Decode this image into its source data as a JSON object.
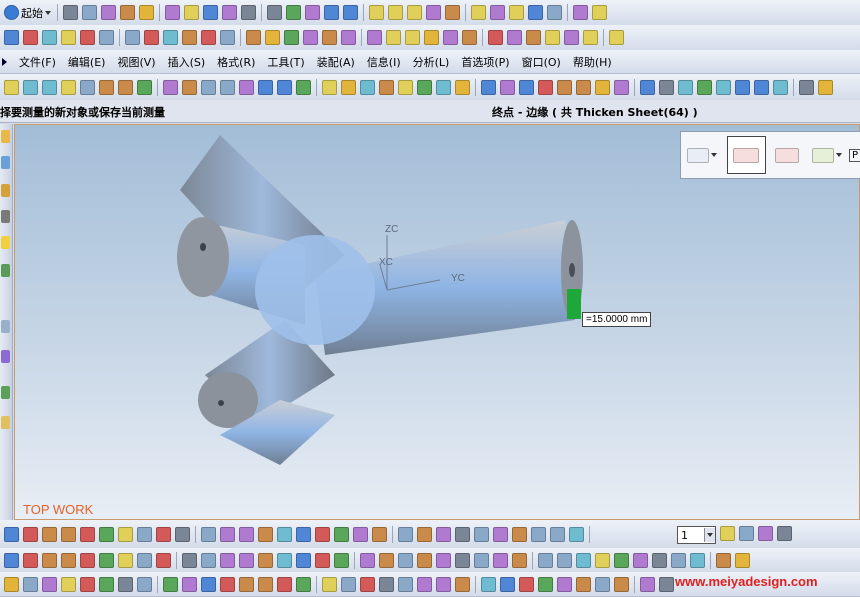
{
  "toolbar_top": {
    "start_label": "起始",
    "icons_row1": [
      "new-icon",
      "open-icon",
      "save-icon",
      "cut-icon",
      "copy-icon",
      "paste-icon",
      "delete-icon",
      "undo-icon",
      "repeat-icon",
      "select-icon",
      "fit-icon",
      "shaded-icon",
      "zoom-icon",
      "rotate-icon",
      "pan-icon",
      "view-cube-icon",
      "layout-icon",
      "wcs-icon",
      "orient-icon",
      "layer-icon",
      "edit-icon",
      "analyze-icon",
      "material-icon",
      "lights-icon",
      "scene-icon",
      "photo-icon",
      "render-icon"
    ],
    "icons_row2": [
      "point-icon",
      "curve-icon",
      "plane-icon",
      "datum-icon",
      "sketch-icon",
      "x2-icon",
      "transform-icon",
      "pattern-icon",
      "feature-icon",
      "block-icon",
      "cylinder-icon",
      "cone-icon",
      "sphere-icon",
      "extrude-icon",
      "revolve-icon",
      "sweep-icon",
      "bulb-icon",
      "spotlight-icon",
      "camera-icon",
      "texture-icon",
      "tiff-icon",
      "gif-icon",
      "jpeg-icon",
      "png-icon",
      "export-icon",
      "print-icon",
      "plot-icon",
      "box-icon",
      "search-icon",
      "magnify-icon",
      "help-icon"
    ]
  },
  "menu": {
    "items": [
      "文件(F)",
      "编辑(E)",
      "视图(V)",
      "插入(S)",
      "格式(R)",
      "工具(T)",
      "装配(A)",
      "信息(I)",
      "分析(L)",
      "首选项(P)",
      "窗口(O)",
      "帮助(H)"
    ]
  },
  "toolbar_mid": {
    "icons": [
      "part-icon",
      "assembly-icon",
      "sheet-icon",
      "draft-icon",
      "shape-icon",
      "surface-icon",
      "mesh-icon",
      "freeform-icon",
      "sketch-icon",
      "curve-icon",
      "extrude-icon",
      "hole-icon",
      "boss-icon",
      "pocket-icon",
      "pad-icon",
      "slot-icon",
      "groove-icon",
      "blend-icon",
      "chamfer-icon",
      "shell-icon",
      "trim-icon",
      "offset-icon",
      "scale-icon",
      "thicken-icon",
      "sew-icon",
      "patch-icon",
      "replace-icon",
      "measure-icon",
      "distance-icon",
      "angle-icon",
      "radius-icon",
      "section-icon",
      "curvature-icon",
      "draft-analysis-icon",
      "deviation-icon",
      "mass-icon",
      "box-icon",
      "pipe-icon",
      "sheet-metal-icon",
      "mold-icon",
      "die-icon",
      "cam-icon"
    ]
  },
  "status": {
    "prompt": "择要测量的新对象或保存当前测量",
    "selection": "终点 - 边缘 ( 共 Thicken Sheet(64) )"
  },
  "viewport": {
    "label": "TOP WORK",
    "axis_zc": "ZC",
    "axis_xc": "XC",
    "axis_yc": "YC",
    "measurement": "=15.0000 mm",
    "model_color": "#8fb8e8"
  },
  "snap_toolbar": {
    "icons": [
      "point-to-point-icon",
      "parallel-distance-icon",
      "perpendicular-distance-icon",
      "curve-measure-icon",
      "more-icon"
    ],
    "extra": "P"
  },
  "toolbar_bottom": {
    "zoom_value": "1",
    "icons_row1": [
      "lines-icon",
      "curve-icon",
      "spline-icon",
      "arc-icon",
      "fillet-icon",
      "trim-icon",
      "extend-icon",
      "offset-icon",
      "rect-icon",
      "circle-icon",
      "polygon-icon",
      "ellipse-icon",
      "text-icon",
      "dim-icon",
      "angle-dim-icon",
      "radius-dim-icon",
      "constraint-icon",
      "relation-icon",
      "mirror-icon",
      "array-icon",
      "project-icon",
      "intersect-icon",
      "hide-icon",
      "show-icon",
      "layer-icon",
      "color-icon",
      "cone-icon",
      "sphere-icon",
      "box-icon",
      "grid-icon",
      "snap-icon"
    ],
    "icons_row2": [
      "select-icon",
      "move-icon",
      "copy-icon",
      "paste-icon",
      "delete-icon",
      "wire-icon",
      "shade-icon",
      "render-icon",
      "light-icon",
      "cam-icon"
    ],
    "watermark": "www.meiyadesign.com"
  }
}
